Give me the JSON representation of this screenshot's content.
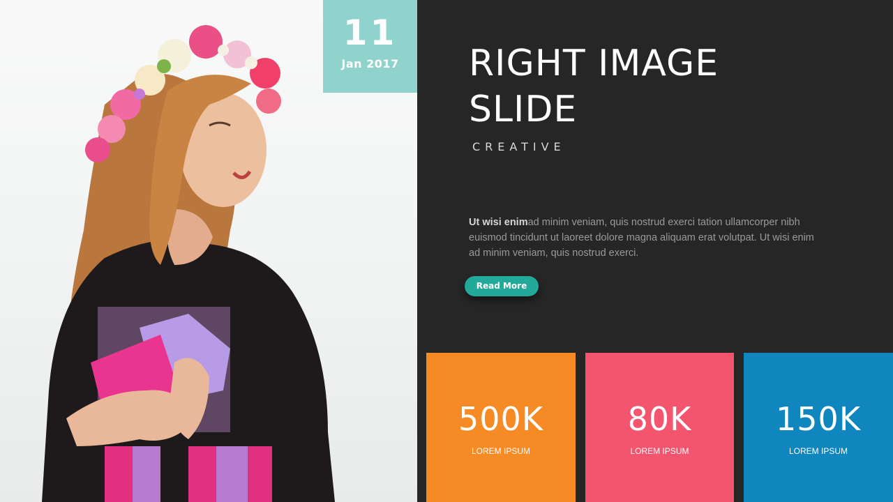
{
  "date_badge": {
    "day": "11",
    "month_year": "Jan 2017"
  },
  "slide": {
    "title_line1": "RIGHT IMAGE",
    "title_line2": "SLIDE",
    "subtitle": "CREATIVE",
    "body_bold": "Ut wisi enim",
    "body_text": "ad minim veniam, quis nostrud exerci tation ullamcorper nibh euismod tincidunt ut laoreet dolore magna aliquam erat volutpat. Ut wisi enim ad minim veniam, quis nostrud exerci.",
    "button_label": "Read More"
  },
  "stats": [
    {
      "value": "500K",
      "label": "LOREM IPSUM",
      "color": "#f68a24"
    },
    {
      "value": "80K",
      "label": "LOREM IPSUM",
      "color": "#f3556f"
    },
    {
      "value": "150K",
      "label": "LOREM IPSUM",
      "color": "#0f86bd"
    }
  ],
  "colors": {
    "background": "#262626",
    "badge": "#8fd3cc",
    "button": "#22a99a"
  },
  "photo": {
    "subject": "woman-with-flower-crown"
  }
}
